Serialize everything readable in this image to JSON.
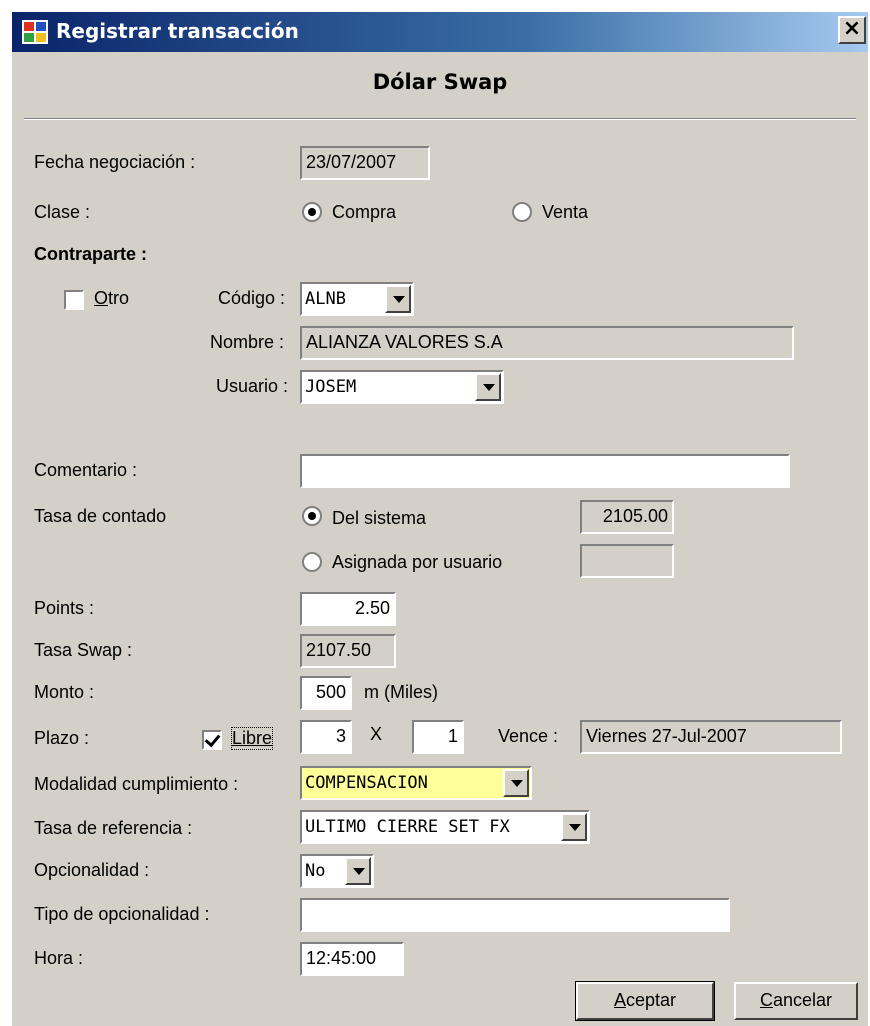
{
  "window": {
    "title": "Registrar transacción",
    "close": "×"
  },
  "heading": "Dólar Swap",
  "fecha": {
    "label": "Fecha negociación :",
    "value": "23/07/2007"
  },
  "clase": {
    "label": "Clase :",
    "compra": "Compra",
    "venta": "Venta",
    "selected": "Compra"
  },
  "contraparte": {
    "label": "Contraparte :",
    "otro_prefix": "O",
    "otro_rest": "tro",
    "codigo_label": "Código :",
    "codigo_value": "ALNB",
    "nombre_label": "Nombre :",
    "nombre_value": "ALIANZA VALORES S.A",
    "usuario_label": "Usuario :",
    "usuario_value": "JOSEM"
  },
  "comentario": {
    "label": "Comentario :",
    "value": ""
  },
  "tasa_contado": {
    "label": "Tasa de contado",
    "del_sistema": "Del sistema",
    "del_sistema_value": "2105.00",
    "asignada": "Asignada por usuario",
    "asignada_value": ""
  },
  "points": {
    "label": "Points :",
    "value": "2.50"
  },
  "tasa_swap": {
    "label": "Tasa Swap :",
    "value": "2107.50"
  },
  "monto": {
    "label": "Monto :",
    "value": "500",
    "unit": "m (Miles)"
  },
  "plazo": {
    "label": "Plazo :",
    "libre": "Libre",
    "libre_checked": true,
    "n1": "3",
    "x": "X",
    "n2": "1",
    "vence_label": "Vence :",
    "vence_value": "Viernes 27-Jul-2007"
  },
  "modalidad": {
    "label": "Modalidad cumplimiento :",
    "value": "COMPENSACION"
  },
  "tasa_referencia": {
    "label": "Tasa de referencia :",
    "value": "ULTIMO CIERRE SET FX"
  },
  "opcionalidad": {
    "label": "Opcionalidad :",
    "value": "No"
  },
  "tipo_opcionalidad": {
    "label": "Tipo de opcionalidad :",
    "value": ""
  },
  "hora": {
    "label": "Hora :",
    "value": "12:45:00"
  },
  "buttons": {
    "aceptar_u": "A",
    "aceptar_rest": "ceptar",
    "cancelar_u": "C",
    "cancelar_rest": "ancelar"
  },
  "colors": {
    "titlebar": "#0a246a",
    "dialog": "#d4d0c8",
    "highlight": "#ffff99"
  }
}
